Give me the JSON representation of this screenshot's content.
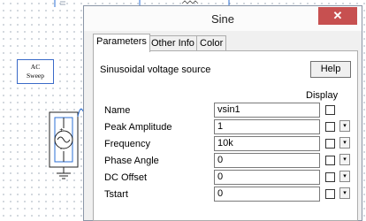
{
  "schematic": {
    "ac_block_line1": "AC",
    "ac_block_line2": "Sweep"
  },
  "dialog": {
    "title": "Sine",
    "close_glyph": "✕",
    "tabs": [
      {
        "label": "Parameters",
        "active": true
      },
      {
        "label": "Other Info",
        "active": false
      },
      {
        "label": "Color",
        "active": false
      }
    ],
    "description": "Sinusoidal voltage source",
    "help_label": "Help",
    "display_header": "Display",
    "rows": [
      {
        "label": "Name",
        "value": "vsin1",
        "has_dropdown": false
      },
      {
        "label": "Peak Amplitude",
        "value": "1",
        "has_dropdown": true
      },
      {
        "label": "Frequency",
        "value": "10k",
        "has_dropdown": true
      },
      {
        "label": "Phase Angle",
        "value": "0",
        "has_dropdown": true
      },
      {
        "label": "DC Offset",
        "value": "0",
        "has_dropdown": true
      },
      {
        "label": "Tstart",
        "value": "0",
        "has_dropdown": true
      }
    ],
    "dropdown_glyph": "▾"
  },
  "colors": {
    "close_button": "#c75050",
    "ac_block_border": "#3a6ac8",
    "wire": "#2b6fd6"
  }
}
